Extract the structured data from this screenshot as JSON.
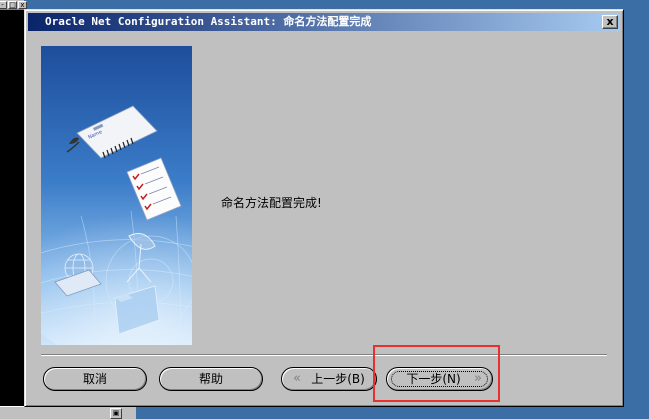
{
  "window": {
    "title": "Oracle Net Configuration Assistant: 命名方法配置完成",
    "close_label": "x"
  },
  "content": {
    "message": "命名方法配置完成!"
  },
  "buttons": {
    "cancel": "取消",
    "help": "帮助",
    "back": "上一步(B)",
    "next": "下一步(N)"
  },
  "illustration": {
    "tag_label": "Name"
  },
  "background": {
    "mini_buttons": [
      "-",
      "□",
      "x"
    ],
    "bottom_button": "▣"
  },
  "colors": {
    "desktop": "#3a6ea5",
    "titlebar_start": "#0a246a",
    "titlebar_end": "#a6caf0",
    "dialog": "#c0c0c0",
    "highlight": "#e8312f"
  }
}
